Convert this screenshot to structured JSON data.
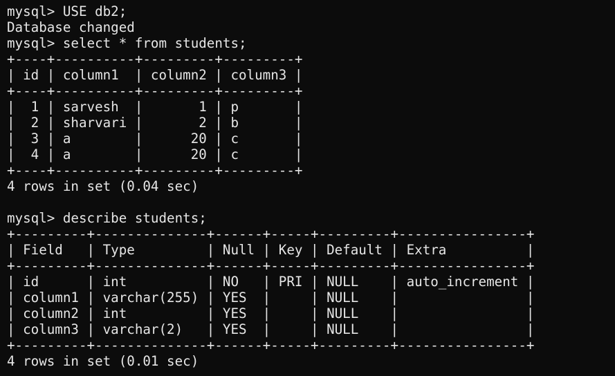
{
  "terminal": {
    "lines": [
      "mysql> USE db2;",
      "Database changed",
      "mysql> select * from students;",
      "+----+----------+---------+---------+",
      "| id | column1  | column2 | column3 |",
      "+----+----------+---------+---------+",
      "|  1 | sarvesh  |       1 | p       |",
      "|  2 | sharvari |       2 | b       |",
      "|  3 | a        |      20 | c       |",
      "|  4 | a        |      20 | c       |",
      "+----+----------+---------+---------+",
      "4 rows in set (0.04 sec)",
      "",
      "mysql> describe students;",
      "+---------+--------------+------+-----+---------+----------------+",
      "| Field   | Type         | Null | Key | Default | Extra          |",
      "+---------+--------------+------+-----+---------+----------------+",
      "| id      | int          | NO   | PRI | NULL    | auto_increment |",
      "| column1 | varchar(255) | YES  |     | NULL    |                |",
      "| column2 | int          | YES  |     | NULL    |                |",
      "| column3 | varchar(2)   | YES  |     | NULL    |                |",
      "+---------+--------------+------+-----+---------+----------------+",
      "4 rows in set (0.01 sec)"
    ]
  }
}
